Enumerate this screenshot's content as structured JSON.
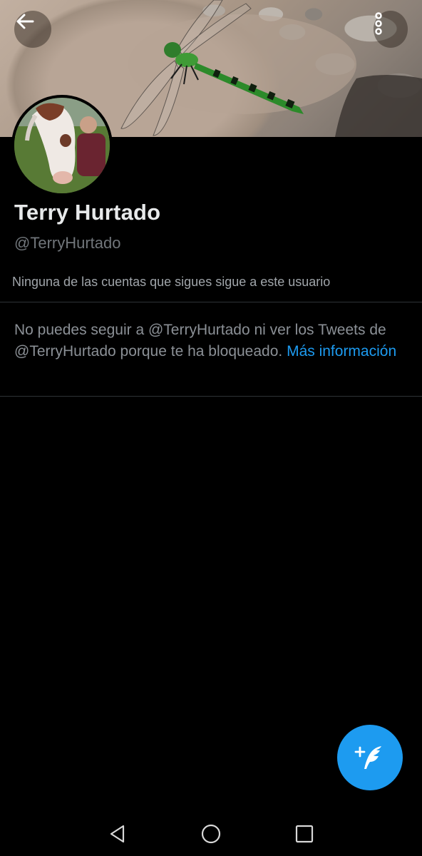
{
  "profile": {
    "name": "Terry Hurtado",
    "handle": "@TerryHurtado",
    "followers_note": "Ninguna de las cuentas que sigues sigue a este usuario"
  },
  "blocked_notice": {
    "text": "No puedes seguir a @TerryHurtado ni ver los Tweets de @TerryHurtado porque te ha bloqueado.",
    "link_label": "Más información"
  },
  "icons": {
    "back": "arrow-left-icon",
    "more": "more-vertical-icon",
    "compose": "compose-tweet-icon",
    "nav_back": "triangle-back-icon",
    "nav_home": "circle-home-icon",
    "nav_recent": "square-recent-icon"
  },
  "colors": {
    "background": "#000000",
    "accent": "#1d9bf0",
    "primary_text": "#e7e9ea",
    "secondary_text": "#71767b",
    "divider": "#2f3336"
  }
}
